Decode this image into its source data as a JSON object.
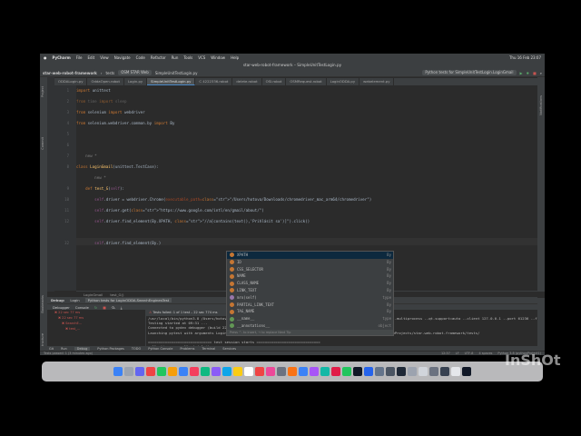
{
  "macos_menu": {
    "app": "PyCharm",
    "items": [
      "File",
      "Edit",
      "View",
      "Navigate",
      "Code",
      "Refactor",
      "Run",
      "Tools",
      "VCS",
      "Window",
      "Help"
    ],
    "status_right": "Thu 16 Feb 23:07"
  },
  "window": {
    "title": "star-web-robot-framework – SimpleUnitTestLogin.py"
  },
  "navbar": {
    "project": "star-web-robot-framework",
    "breadcrumb1": "tests",
    "breadcrumb2": "OSM STAR Web",
    "breadcrumb3": "SimpleUnitTestLogin.py",
    "run_config": "Python tests for SimpleUnitTestLogin.LoginGmail"
  },
  "tabs": [
    "ODDALogin.py",
    "OddaOpen.robot",
    "Login.py",
    "SimpleUnitTestLogin.py",
    "C 4222336.robot",
    "delete.robot",
    "OSI.robot",
    "OSMRequest.robot",
    "LoginODDA.py",
    "webelement.py"
  ],
  "active_tab_index": 3,
  "editor": {
    "lines": [
      {
        "n": "1",
        "text": "import unittest"
      },
      {
        "n": "2",
        "text": "from time import sleep"
      },
      {
        "n": "3",
        "text": "from selenium import webdriver"
      },
      {
        "n": "4",
        "text": "from selenium.webdriver.common.by import By"
      },
      {
        "n": "5",
        "text": ""
      },
      {
        "n": "6",
        "text": ""
      },
      {
        "n": "7",
        "text": "    new *"
      },
      {
        "n": "8",
        "text": "class LoginGmail(unittest.TestCase):"
      },
      {
        "n": "",
        "text": "        new *"
      },
      {
        "n": "9",
        "text": "    def test_G(self):"
      },
      {
        "n": "10",
        "text": "        self.driver = webdriver.Chrome(executable_path=\"/Users/hotova/Downloads/chromedriver_mac_arm64/chromedriver\")"
      },
      {
        "n": "11",
        "text": "        self.driver.get(\"https://www.google.com/intl/en/gmail/about/\")"
      },
      {
        "n": "12",
        "text": "        self.driver.find_element(By.XPATH, \"//a[contains(text(),'Prihlásit sa')]\").click()"
      },
      {
        "n": "",
        "text": ""
      },
      {
        "n": "32",
        "text": "        self.driver.find_element(By.)"
      }
    ],
    "breadcrumb": [
      "LoginGmail",
      "test_G()"
    ]
  },
  "autocomplete": {
    "items": [
      {
        "name": "XPATH",
        "type": "By"
      },
      {
        "name": "ID",
        "type": "By"
      },
      {
        "name": "CSS_SELECTOR",
        "type": "By"
      },
      {
        "name": "NAME",
        "type": "By"
      },
      {
        "name": "CLASS_NAME",
        "type": "By"
      },
      {
        "name": "LINK_TEXT",
        "type": "By"
      },
      {
        "name": "mro(self)",
        "type": "type"
      },
      {
        "name": "PARTIAL_LINK_TEXT",
        "type": "By"
      },
      {
        "name": "TAG_NAME",
        "type": "By"
      },
      {
        "name": "__name__",
        "type": "type"
      },
      {
        "name": "__annotations__",
        "type": "object"
      }
    ],
    "footer": "Press ^. to insert, → to replace   Next Tip"
  },
  "debug": {
    "tabs": [
      "Debug:",
      "Login",
      "Python tests for LoginODDA.SearchEnginesTest"
    ],
    "subtabs": [
      "Debugger",
      "Console"
    ],
    "status": "Tests failed: 1 of 1 test – 22 sec 774 ms",
    "tree": [
      "22 sec 77 ms",
      "22 sec 77 ms",
      "SearchE...",
      "test_..."
    ],
    "console": [
      "/usr/local/bin/python3.8 /Users/hotova/Applications/PyCharm.app/Contents/plugins/python-ce/helpers/pydev/pydevd.py --multiprocess --qt-support=auto --client 127.0.0.1 --port 61236 --file /Applications/PyCharm CE.app/Contents/plugins/python-c",
      "Testing started at 09:31 ...",
      "Connected to pydev debugger (build 223.8214.51)",
      "Launching pytest with arguments LoginODDA.py::SearchEnginesTest --no-header --no-summary -q in /Users/hotova/PycharmProjects/star-web-robot-framework/tests/",
      "",
      "============================== test session starts ==============================",
      "collecting ... collected 1 item",
      "",
      "LoginODDA.py::SearchEnginesTest::test_ODDA FAILED                    [100%]",
      "LoginODDA.py:1 (SearchEnginesTest.test_ODDA)"
    ]
  },
  "bottom_tools": [
    "Git",
    "Run",
    "Debug",
    "Python Packages",
    "TODO",
    "Python Console",
    "Problems",
    "Terminal",
    "Services"
  ],
  "statusbar": {
    "left": "Tests passed: 1 (3 minutes ago)",
    "right": [
      "12:37",
      "LF",
      "UTF-8",
      "4 spaces",
      "Python 3.8 (pythonProject1)"
    ]
  },
  "watermark": "InShOt",
  "colors": {
    "accent": "#4a88c7",
    "editor_bg": "#2b2b2b",
    "panel_bg": "#3c3f41",
    "error": "#ff6b68"
  }
}
